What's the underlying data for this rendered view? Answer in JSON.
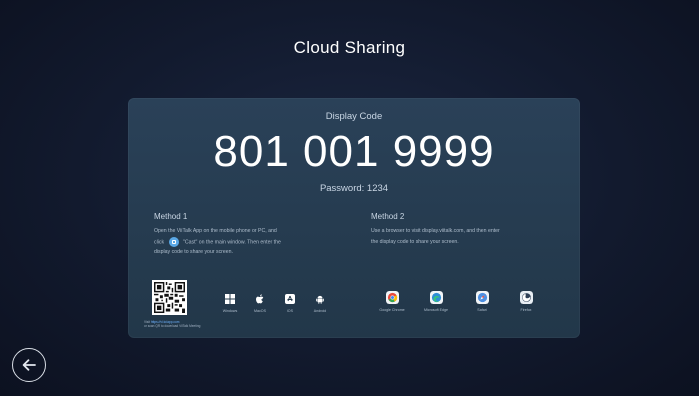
{
  "title": "Cloud Sharing",
  "display_code": {
    "label": "Display Code",
    "code": "801 001 9999",
    "password": "Password: 1234"
  },
  "method1": {
    "title": "Method 1",
    "line1": "Open the ViiTalk App on the mobile phone or PC, and",
    "line2_pre": "click",
    "line2_post": "\"Cast\" on the main window. Then enter the",
    "line3": "display code to share your screen.",
    "cast_icon": "cast-icon",
    "qr_caption_link": "Visit",
    "qr_caption_url": "https://vi.to/app.com",
    "qr_caption_text": "or scan QR to download ViiTalk Meeting",
    "platforms": [
      {
        "label": "Windows",
        "icon": "windows-icon"
      },
      {
        "label": "MacOS",
        "icon": "apple-icon"
      },
      {
        "label": "iOS",
        "icon": "app-store-icon"
      },
      {
        "label": "Android",
        "icon": "android-icon"
      }
    ]
  },
  "method2": {
    "title": "Method 2",
    "line1": "Use a browser to visit display.viitalk.com,  and then enter",
    "line2": "the display code to share your screen.",
    "browsers": [
      {
        "label": "Google Chrome",
        "icon": "chrome-icon",
        "color": "#e8493b"
      },
      {
        "label": "Microsoft Edge",
        "icon": "edge-icon",
        "color": "#2f8fd6"
      },
      {
        "label": "Safari",
        "icon": "safari-icon",
        "color": "#4d8fe0"
      },
      {
        "label": "Firefox",
        "icon": "firefox-icon",
        "color": "#e8eef4"
      }
    ]
  },
  "back_button": {
    "icon": "back-arrow-icon"
  }
}
